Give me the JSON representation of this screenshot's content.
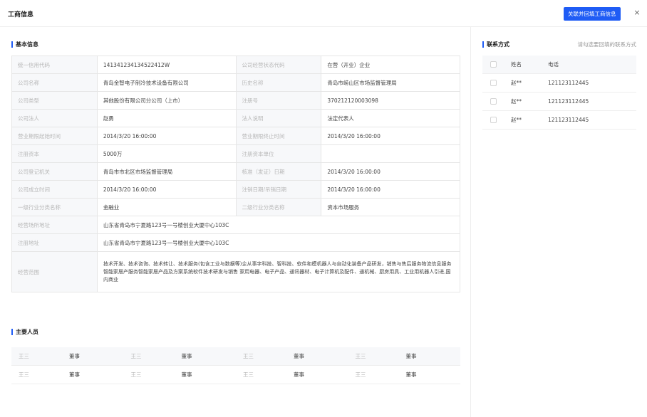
{
  "header": {
    "title": "工商信息",
    "fill_button": "关联并回填工商信息",
    "close_icon": "×"
  },
  "basic": {
    "title": "基本信息",
    "rows": [
      [
        {
          "label": "统一信用代码",
          "value": "141341234134522412W"
        },
        {
          "label": "公司经营状态代码",
          "value": "在营（开业）企业"
        }
      ],
      [
        {
          "label": "公司名称",
          "value": "青岛金智电子制冷技术设备有限公司"
        },
        {
          "label": "历史名称",
          "value": "青岛市崂山区市场监督管理局"
        }
      ],
      [
        {
          "label": "公司类型",
          "value": "其他股份有限公司分公司（上市）"
        },
        {
          "label": "注册号",
          "value": "370212120003098"
        }
      ],
      [
        {
          "label": "公司法人",
          "value": "赵勇"
        },
        {
          "label": "法人说明",
          "value": "法定代表人"
        }
      ],
      [
        {
          "label": "营业期限起始时间",
          "value": "2014/3/20 16:00:00"
        },
        {
          "label": "营业期限终止时间",
          "value": "2014/3/20 16:00:00"
        }
      ],
      [
        {
          "label": "注册资本",
          "value": "5000万"
        },
        {
          "label": "注册资本单位",
          "value": ""
        }
      ],
      [
        {
          "label": "公司登记机关",
          "value": "青岛市市北区市场监督管理局"
        },
        {
          "label": "核准（发证）日期",
          "value": "2014/3/20 16:00:00"
        }
      ],
      [
        {
          "label": "公司成立时间",
          "value": "2014/3/20 16:00:00"
        },
        {
          "label": "注销日期/吊销日期",
          "value": "2014/3/20 16:00:00"
        }
      ],
      [
        {
          "label": "一级行业分类名称",
          "value": "金融业"
        },
        {
          "label": "二级行业分类名称",
          "value": "资本市场服务"
        }
      ]
    ],
    "address_label": "经营场所地址",
    "address_value": "山东省青岛市宁夏路123号一号楼创业大厦中心103C",
    "reg_address_label": "注册地址",
    "reg_address_value": "山东省青岛市宁夏路123号一号楼创业大厦中心103C",
    "scope_label": "经营范围",
    "scope_value": "技术开发、技术咨询、技术转让、技术服务(包含工业与数据等)企从事字科技、智科技、软件和模机器人与自动化装备产品研发，销售与售后服务物流信息服务智能家居产服务智能家居产品及方案系统软件技术研发与销售 家用电器、电子产品、通讯器材、电子计算机及配件、通机械、厨房用具、工业用机器人引进,国内商业"
  },
  "staff": {
    "title": "主要人员",
    "rows": [
      [
        {
          "name": "王三",
          "role": "董事"
        },
        {
          "name": "王三",
          "role": "董事"
        },
        {
          "name": "王三",
          "role": "董事"
        },
        {
          "name": "王三",
          "role": "董事"
        }
      ],
      [
        {
          "name": "王三",
          "role": "董事"
        },
        {
          "name": "王三",
          "role": "董事"
        },
        {
          "name": "王三",
          "role": "董事"
        },
        {
          "name": "王三",
          "role": "董事"
        }
      ]
    ]
  },
  "contact": {
    "title": "联系方式",
    "hint": "请勾选要回填的联系方式",
    "col_name": "姓名",
    "col_phone": "电话",
    "rows": [
      {
        "name": "赵**",
        "phone": "121123112445"
      },
      {
        "name": "赵**",
        "phone": "121123112445"
      },
      {
        "name": "赵**",
        "phone": "121123112445"
      }
    ]
  },
  "colors": {
    "accent": "#1f5cf5",
    "label_bg": "#f7f8fa",
    "border": "#e6e6e6"
  }
}
